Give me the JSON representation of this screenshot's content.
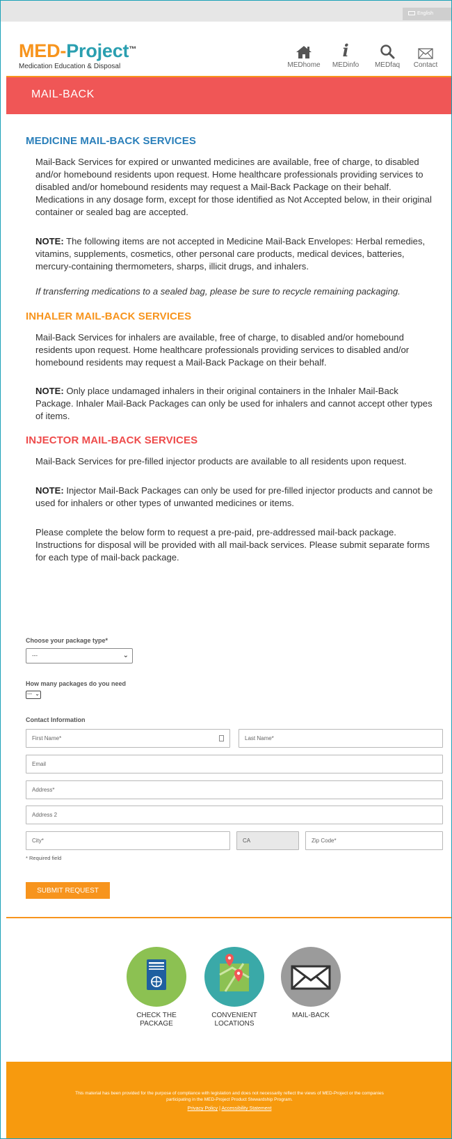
{
  "language": {
    "label": "English",
    "icon": "flag-icon"
  },
  "header": {
    "logo_med": "MED-",
    "logo_project": "Project",
    "logo_tm": "™",
    "logo_subtitle": "Medication Education & Disposal",
    "nav": [
      {
        "label": "MEDhome",
        "icon": "home-icon"
      },
      {
        "label": "MEDinfo",
        "icon": "info-icon"
      },
      {
        "label": "MEDfaq",
        "icon": "search-icon"
      },
      {
        "label": "Contact",
        "icon": "mail-icon"
      }
    ]
  },
  "banner": {
    "title": "MAIL-BACK"
  },
  "sections": {
    "medicine": {
      "heading": "MEDICINE MAIL-BACK SERVICES",
      "body": "Mail-Back Services for expired or unwanted medicines are available, free of charge, to disabled and/or homebound residents upon request. Home healthcare professionals providing services to disabled and/or homebound residents may request a Mail-Back Package on their behalf. Medications in any dosage form, except for those identified as Not Accepted below, in their original container or sealed bag are accepted.",
      "note_label": "NOTE:",
      "note": " The following items are not accepted in Medicine Mail-Back Envelopes: Herbal remedies, vitamins, supplements, cosmetics, other personal care products, medical devices, batteries, mercury-containing thermometers, sharps, illicit drugs, and inhalers.",
      "italic": "If transferring medications to a sealed bag, please be sure to recycle remaining packaging."
    },
    "inhaler": {
      "heading": "INHALER MAIL-BACK SERVICES",
      "body": "Mail-Back Services for inhalers are available, free of charge, to disabled and/or homebound residents upon request. Home healthcare professionals providing services to disabled and/or homebound residents may request a Mail-Back Package on their behalf.",
      "note_label": "NOTE:",
      "note": " Only place undamaged inhalers in their original containers in the Inhaler Mail-Back Package. Inhaler Mail-Back Packages can only be used for inhalers and cannot accept other types of items."
    },
    "injector": {
      "heading": "INJECTOR MAIL-BACK SERVICES",
      "body": "Mail-Back Services for pre-filled injector products are available to all residents upon request.",
      "note_label": "NOTE:",
      "note": " Injector Mail-Back Packages can only be used for pre-filled injector products and cannot be used for inhalers or other types of unwanted medicines or items.",
      "instructions": "Please complete the below form to request a pre-paid, pre-addressed mail-back package. Instructions for disposal will be provided with all mail-back services. Please submit separate forms for each type of mail-back package."
    }
  },
  "form": {
    "package_type_label": "Choose your package type*",
    "package_type_value": "---",
    "quantity_label": "How many packages do you need",
    "quantity_value": "---",
    "contact_label": "Contact Information",
    "first_name_placeholder": "First Name*",
    "last_name_placeholder": "Last Name*",
    "email_placeholder": "Email",
    "address_placeholder": "Address*",
    "address2_placeholder": "Address 2",
    "city_placeholder": "City*",
    "state_value": "CA",
    "zip_placeholder": "Zip Code*",
    "required_note": "* Required field",
    "submit_label": "SUBMIT REQUEST"
  },
  "cta": [
    {
      "label": "CHECK THE PACKAGE",
      "icon": "package-icon",
      "color": "#8cc152"
    },
    {
      "label": "CONVENIENT LOCATIONS",
      "icon": "map-icon",
      "color": "#3aa9a8"
    },
    {
      "label": "MAIL-BACK",
      "icon": "envelope-icon",
      "color": "#9b9b9b"
    }
  ],
  "footer": {
    "disclaimer": "This material has been provided for the purpose of compliance with legislation and does not necessarily reflect the views of MED-Project or the companies participating in the MED-Project Product Stewardship Program.",
    "privacy_link": "Privacy Policy",
    "separator": " | ",
    "accessibility_link": "Accessibility Statement"
  },
  "colors": {
    "brand_orange": "#f7941d",
    "brand_teal": "#2a9fb0",
    "banner_red": "#f05656",
    "heading_blue": "#2a7fba",
    "heading_red": "#ee4b4b"
  }
}
